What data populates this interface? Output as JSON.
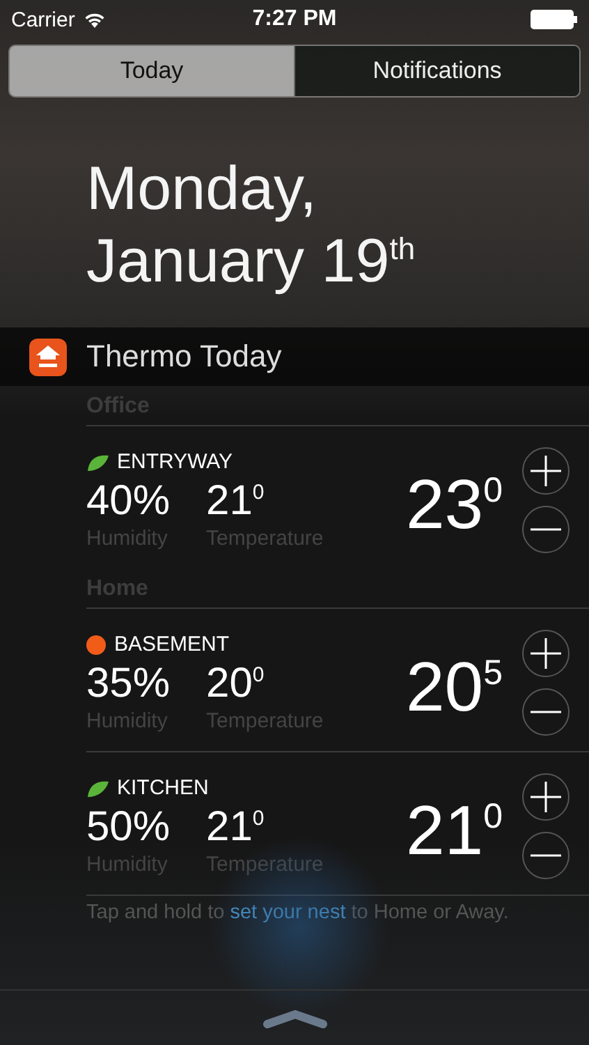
{
  "status_bar": {
    "carrier": "Carrier",
    "time": "7:27 PM"
  },
  "tabs": [
    {
      "label": "Today",
      "selected": true
    },
    {
      "label": "Notifications",
      "selected": false
    }
  ],
  "date": {
    "line_1": "Monday,",
    "line_2": "January 19$^{th}$"
  },
  "widget": {
    "title": "Thermo Today",
    "groups": [
      {
        "name": "Office",
        "devices": [
          {
            "kind": "leaf",
            "name": "ENTRYWAY",
            "humidity": "40%",
            "humidity_label": "Humidity",
            "temperature": "21$^{0}$",
            "temperature_label": "Temperature",
            "target": "23$^{0}$"
          }
        ]
      },
      {
        "name": "Home",
        "devices": [
          {
            "kind": "dot",
            "color": "#f25c19",
            "name": "BASEMENT",
            "humidity": "35%",
            "humidity_label": "Humidity",
            "temperature": "20$^{0}$",
            "temperature_label": "Temperature",
            "target": "20$^{5}$"
          },
          {
            "kind": "leaf",
            "name": "KITCHEN",
            "humidity": "50%",
            "humidity_label": "Humidity",
            "temperature": "21$^{0}$",
            "temperature_label": "Temperature",
            "target": "21$^{0}$"
          }
        ]
      }
    ],
    "footer": {
      "before": "Tap and hold to ",
      "link": "set your nest",
      "after": " to Home or Away."
    }
  }
}
